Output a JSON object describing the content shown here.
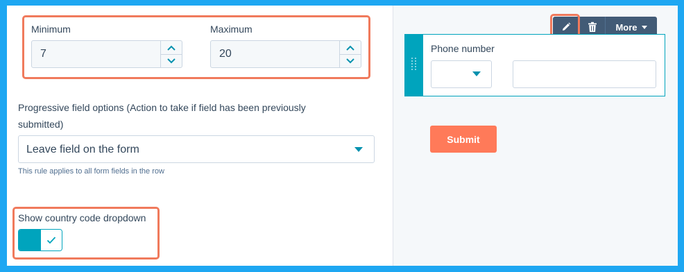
{
  "settings": {
    "minimum_label": "Minimum",
    "minimum_value": "7",
    "maximum_label": "Maximum",
    "maximum_value": "20",
    "progressive_label_line1": "Progressive field options (Action to take if field has been previously",
    "progressive_label_line2": "submitted)",
    "progressive_selected": "Leave field on the form",
    "progressive_help": "This rule applies to all form fields in the row",
    "country_code_label": "Show country code dropdown",
    "country_code_enabled": true
  },
  "preview": {
    "toolbar": {
      "edit_icon": "pencil-icon",
      "delete_icon": "trash-icon",
      "more_label": "More"
    },
    "field_label": "Phone number",
    "submit_label": "Submit"
  },
  "colors": {
    "accent": "#00a4bd",
    "highlight": "#f07a5c",
    "submit": "#ff7a59",
    "frame": "#1ea7f2",
    "toolbar": "#425b76"
  }
}
